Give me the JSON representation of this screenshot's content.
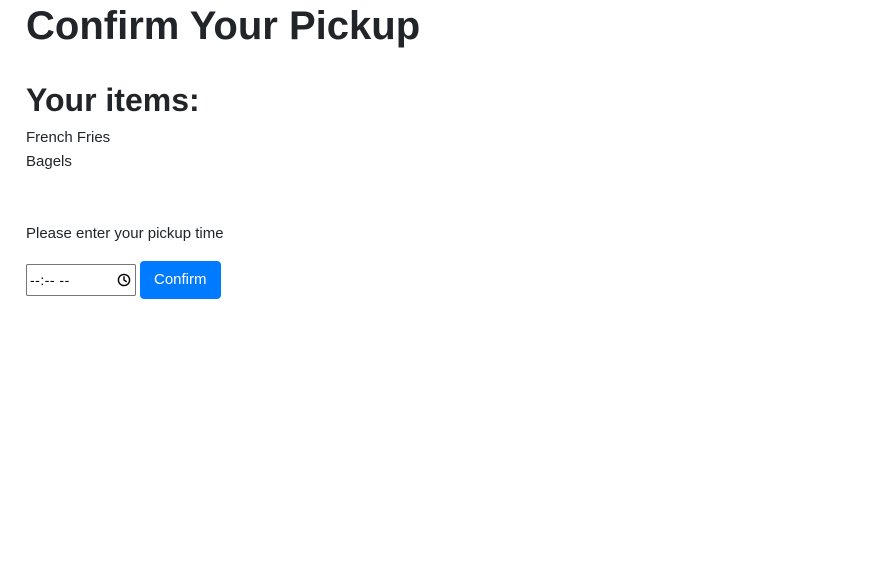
{
  "page": {
    "title": "Confirm Your Pickup"
  },
  "items_section": {
    "heading": "Your items:",
    "items": [
      "French Fries",
      "Bagels"
    ]
  },
  "pickup": {
    "prompt": "Please enter your pickup time",
    "time_display": "--:-- --",
    "clock_icon": "clock-icon",
    "confirm_label": "Confirm"
  },
  "colors": {
    "text": "#212529",
    "button_bg": "#007bff",
    "button_text": "#ffffff"
  }
}
